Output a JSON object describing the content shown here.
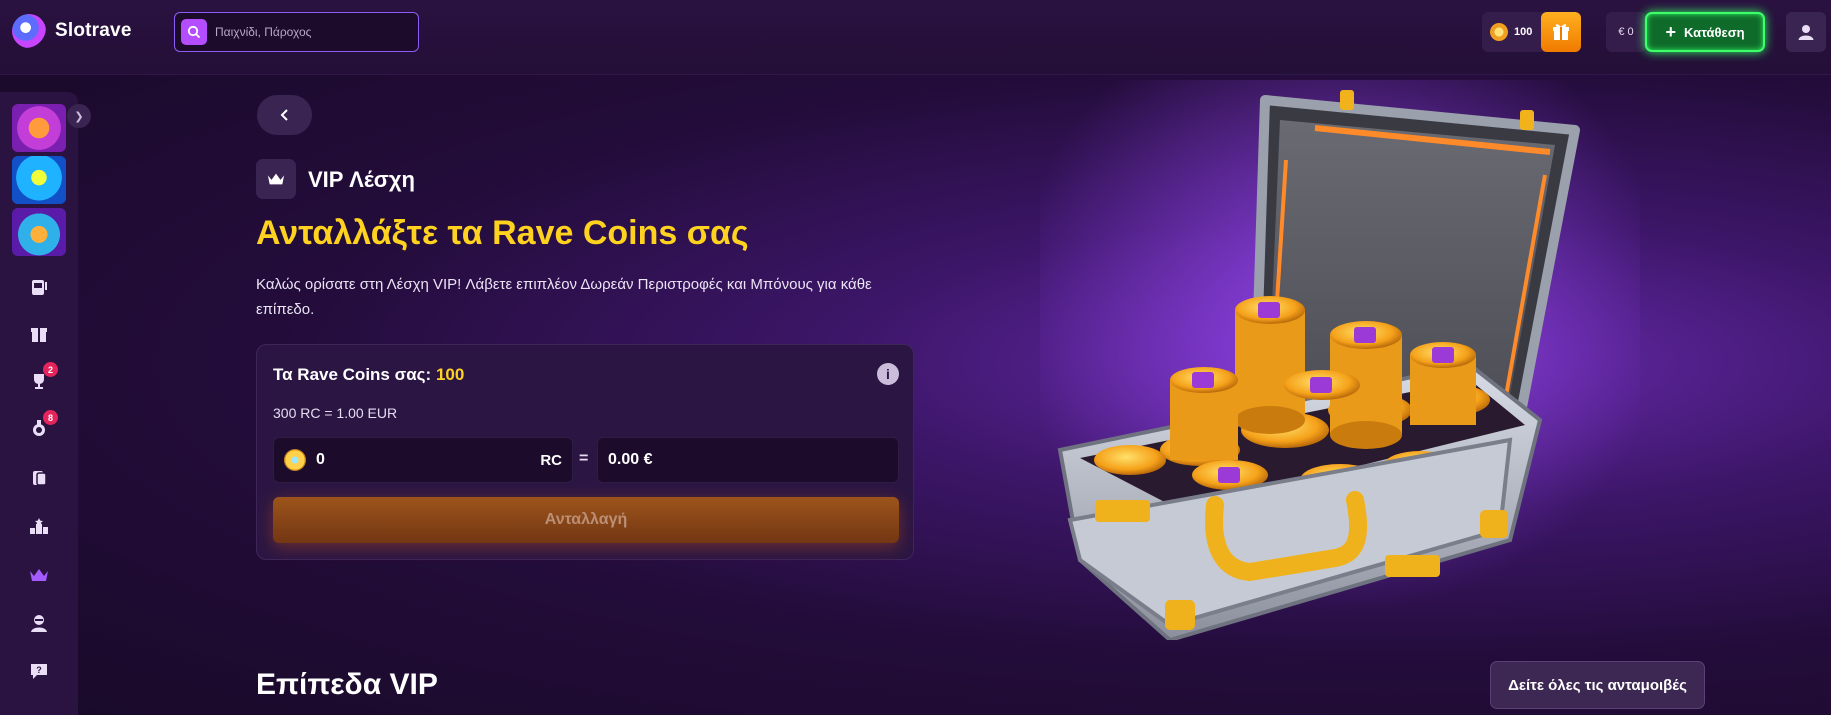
{
  "header": {
    "logo_text": "Slotrave",
    "search_placeholder": "Παιχνίδι, Πάροχος",
    "rave_coins": "100",
    "balance": "€ 0",
    "deposit_label": "Κατάθεση"
  },
  "sidebar": {
    "badges": {
      "trophy": "2",
      "medal": "8"
    },
    "items": [
      "slots-icon",
      "gift-box-icon",
      "trophy-icon",
      "medal-icon",
      "cards-icon",
      "leaderboard-icon",
      "crown-icon",
      "agent-icon",
      "help-icon"
    ]
  },
  "page": {
    "section_label": "VIP Λέσχη",
    "title": "Ανταλλάξτε τα Rave Coins σας",
    "description": "Καλώς ορίσατε στη Λέσχη VIP! Λάβετε επιπλέον Δωρεάν Περιστροφές και Μπόνους για κάθε επίπεδο."
  },
  "exchange": {
    "heading": "Τα Rave Coins σας:",
    "coins_value": "100",
    "rate": "300 RC = 1.00 EUR",
    "rc_value": "0",
    "rc_unit": "RC",
    "equals": "=",
    "eur_value": "0.00 €",
    "button_label": "Ανταλλαγή"
  },
  "vip": {
    "levels_title": "Επίπεδα VIP",
    "rewards_button": "Δείτε όλες τις ανταμοιβές"
  },
  "colors": {
    "accent_yellow": "#ffd21f",
    "deposit_green": "#3dff6a",
    "purple_bg": "#1c0a2c",
    "exchange_orange": "#a85a18"
  }
}
